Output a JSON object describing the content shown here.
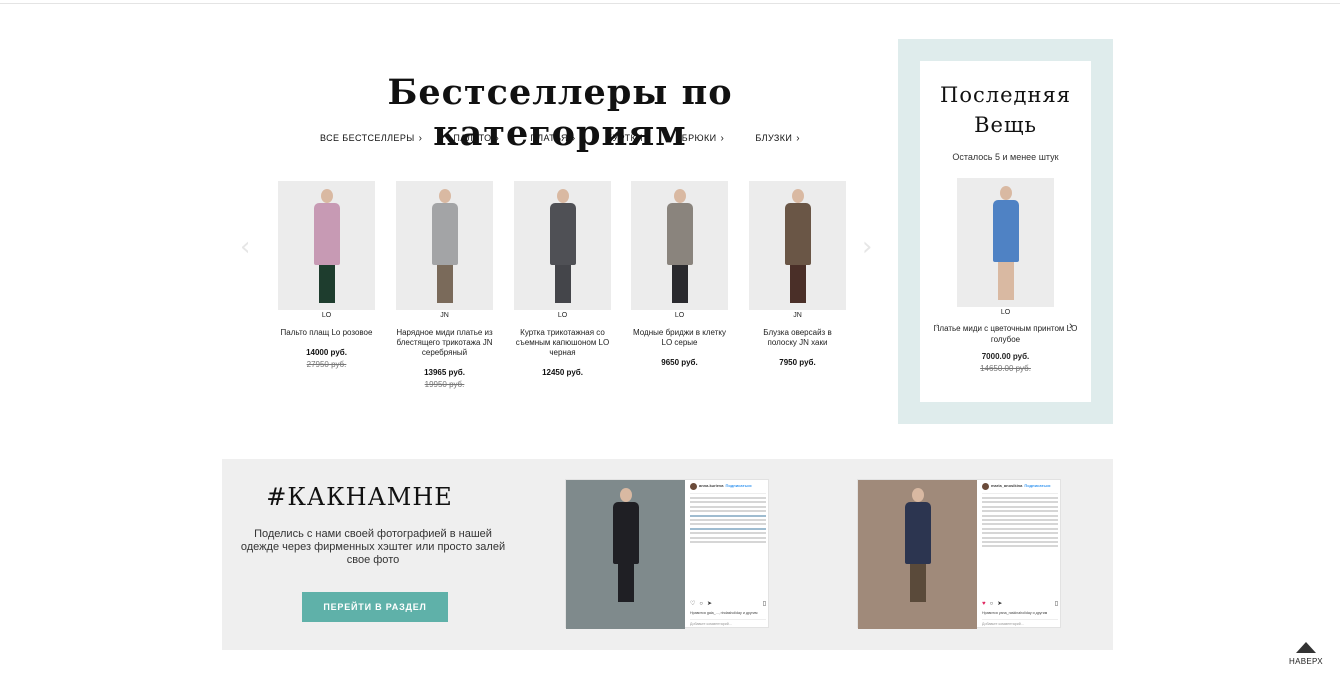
{
  "bestsellers": {
    "title": "Бестселлеры по категориям",
    "categories": [
      {
        "label": "ВСЕ БЕСТСЕЛЛЕРЫ"
      },
      {
        "label": "ПАЛЬТО"
      },
      {
        "label": "ПЛАТЬЯ"
      },
      {
        "label": "КУРТКИ"
      },
      {
        "label": "БРЮКИ"
      },
      {
        "label": "БЛУЗКИ"
      }
    ],
    "arrow_left": "‹",
    "arrow_right": "›",
    "products": [
      {
        "brand": "LO",
        "name": "Пальто плащ Lo розовое",
        "price": "14000 руб.",
        "old_price": "27950 руб.",
        "color": "#c79ab4",
        "legs": "#1e3d2e"
      },
      {
        "brand": "JN",
        "name": "Нарядное миди платье из блестящего трикотажа JN серебряный",
        "price": "13965 руб.",
        "old_price": "19950 руб.",
        "color": "#a3a4a6",
        "legs": "#7a6a5a"
      },
      {
        "brand": "LO",
        "name": "Куртка трикотажная со съемным капюшоном LO черная",
        "price": "12450 руб.",
        "old_price": "",
        "color": "#4f5055",
        "legs": "#44454a"
      },
      {
        "brand": "LO",
        "name": "Модные бриджи в клетку LO серые",
        "price": "9650 руб.",
        "old_price": "",
        "color": "#8a847d",
        "legs": "#2a2a2e"
      },
      {
        "brand": "JN",
        "name": "Блузка оверсайз в полоску JN хаки",
        "price": "7950 руб.",
        "old_price": "",
        "color": "#6a5646",
        "legs": "#4a2f28"
      }
    ]
  },
  "last_item": {
    "title_line1": "Последняя",
    "title_line2": "Вещь",
    "subtitle": "Осталось 5 и менее штук",
    "brand": "LO",
    "name": "Платье миди с цветочным принтом LO голубое",
    "price": "7000.00 руб.",
    "old_price": "14650.00 руб.",
    "color": "#4f82c4",
    "arrow_left": "‹",
    "arrow_right": "›"
  },
  "hashtag": {
    "title": "#КАКНАМНЕ",
    "text": "Поделись с нами своей фотографией в нашей одежде через фирменных хэштег или просто залей свое фото",
    "button": "ПЕРЕЙТИ В РАЗДЕЛ",
    "posts": [
      {
        "username": "anna.kurieva",
        "follow": "Подписаться",
        "likes": "Нравится gaia_..., rindasholiday и другим",
        "comment": "Добавьте комментарий...",
        "photo_color": "#7f8a8c"
      },
      {
        "username": "maria_anosikina",
        "follow": "Подписаться",
        "likes": "Нравится yana_raskinaholiday и другим",
        "comment": "Добавьте комментарий...",
        "photo_color": "#a08a7a"
      }
    ]
  },
  "to_top": {
    "label": "НАВЕРХ"
  }
}
